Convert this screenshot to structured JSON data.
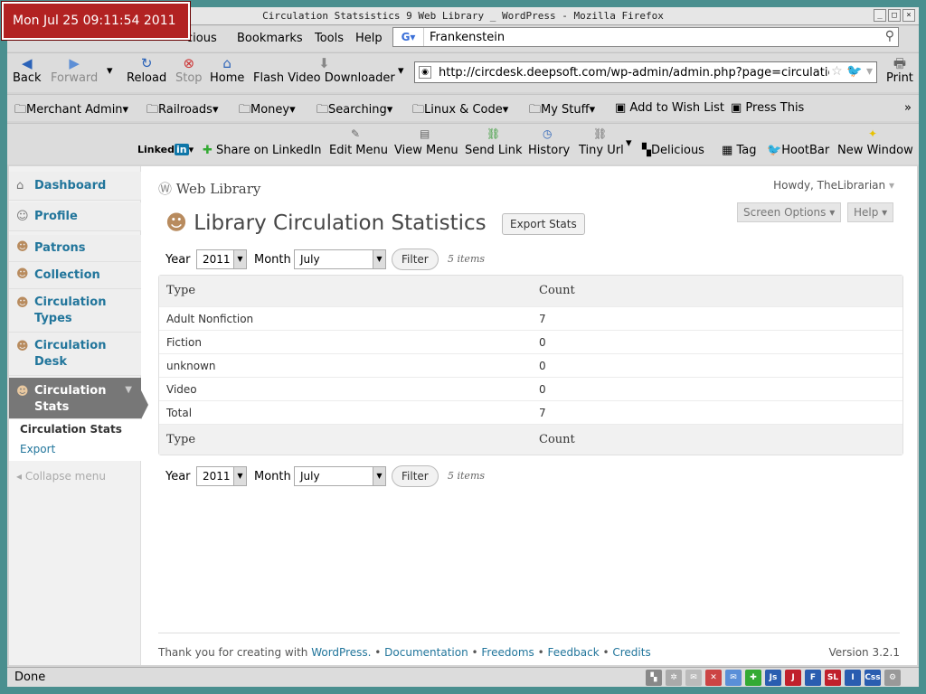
{
  "window": {
    "title": "Circulation Statsistics  9 Web Library  _ WordPress - Mozilla Firefox",
    "clock": "Mon Jul 25 09:11:54 2011"
  },
  "menu": {
    "partial_history": "cious",
    "bookmarks": "Bookmarks",
    "tools": "Tools",
    "help": "Help"
  },
  "search": {
    "engine_icon": "google-icon",
    "value": "Frankenstein"
  },
  "nav": {
    "back": "Back",
    "forward": "Forward",
    "reload": "Reload",
    "stop": "Stop",
    "home": "Home",
    "flash": "Flash Video Downloader",
    "print": "Print",
    "url": "http://circdesk.deepsoft.com/wp-admin/admin.php?page=circulatic"
  },
  "bookmarks": [
    "Merchant Admin",
    "Railroads",
    "Money",
    "Searching",
    "Linux & Code",
    "My Stuff",
    "Add to Wish List",
    "Press This"
  ],
  "addons": {
    "linkedin": "Linked",
    "linkedin_in": "in",
    "share": "Share on LinkedIn",
    "edit_menu": "Edit Menu",
    "view_menu": "View Menu",
    "send_link": "Send Link",
    "history": "History",
    "tiny_url": "Tiny Url",
    "delicious": "Delicious",
    "tag": "Tag",
    "hootbar": "HootBar",
    "new_window": "New Window"
  },
  "sidebar": {
    "dashboard": "Dashboard",
    "profile": "Profile",
    "patrons": "Patrons",
    "collection": "Collection",
    "circ_types_1": "Circulation",
    "circ_types_2": "Types",
    "circ_desk_1": "Circulation",
    "circ_desk_2": "Desk",
    "circ_stats_1": "Circulation",
    "circ_stats_2": "Stats",
    "sub_stats": "Circulation Stats",
    "sub_export": "Export",
    "collapse": "Collapse menu"
  },
  "header": {
    "site": "Web Library",
    "howdy": "Howdy, TheLibrarian",
    "screen_options": "Screen Options",
    "help": "Help"
  },
  "main": {
    "title": "Library Circulation Statistics",
    "export_btn": "Export Stats",
    "year_label": "Year",
    "month_label": "Month",
    "year": "2011",
    "month": "July",
    "filter": "Filter",
    "items": "5 items"
  },
  "table": {
    "headers": [
      "Type",
      "Count"
    ],
    "rows": [
      [
        "Adult Nonfiction",
        "7"
      ],
      [
        "Fiction",
        "0"
      ],
      [
        "unknown",
        "0"
      ],
      [
        "Video",
        "0"
      ],
      [
        "Total",
        "7"
      ]
    ]
  },
  "footer": {
    "thanks": "Thank you for creating with ",
    "wordpress": "WordPress.",
    "sep": " • ",
    "documentation": "Documentation",
    "freedoms": "Freedoms",
    "feedback": "Feedback",
    "credits": "Credits",
    "version": "Version 3.2.1"
  },
  "status": {
    "text": "Done",
    "icons": [
      "Js",
      "J",
      "F",
      "SL",
      "I",
      "Css"
    ]
  }
}
